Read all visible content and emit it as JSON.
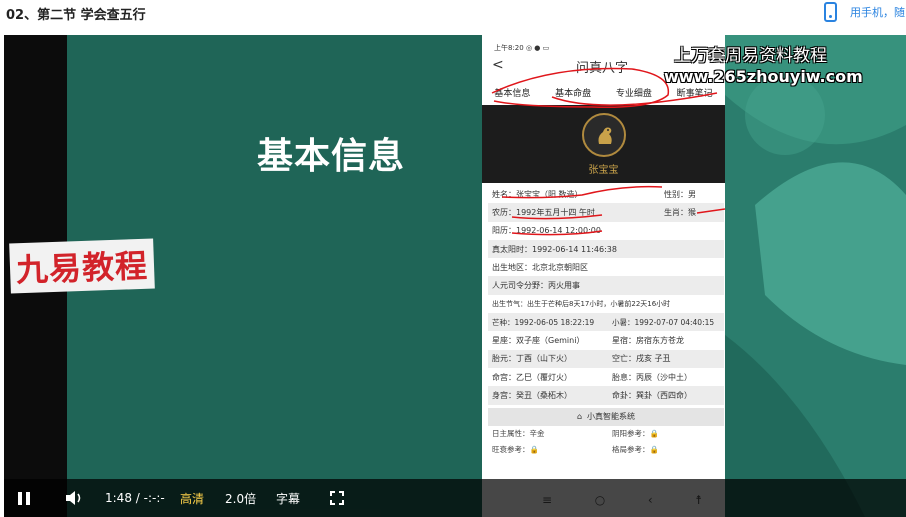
{
  "header": {
    "title": "02、第二节 学会查五行",
    "mobile_link": "用手机，随"
  },
  "slide": {
    "heading": "基本信息",
    "badge": "九易教程"
  },
  "watermark": {
    "line1": "上万套周易资料教程",
    "line2": "www.265zhouyiw.com"
  },
  "phone": {
    "status": "上午8:20 ◎ ● ▭",
    "back": "<",
    "title": "问真八字",
    "tabs": [
      "基本信息",
      "基本命盘",
      "专业细盘",
      "断事笔记"
    ],
    "hero_name": "张宝宝",
    "rows": [
      {
        "left": "姓名：张宝宝（阳 数造）",
        "right": "性别：男"
      },
      {
        "left": "农历：1992年五月十四 午时",
        "right": "生肖：猴"
      },
      {
        "left": "阳历：1992-06-14 12:00:00",
        "right": ""
      },
      {
        "left": "真太阳时：1992-06-14 11:46:38",
        "right": ""
      },
      {
        "left": "出生地区：北京北京朝阳区",
        "right": ""
      },
      {
        "left": "人元司令分野：丙火用事",
        "right": ""
      },
      {
        "left": "出生节气：出生于芒种后8天17小时，小暑前22天16小时",
        "right": ""
      },
      {
        "left": "芒种：1992-06-05 18:22:19",
        "right": "小暑：1992-07-07 04:40:15"
      },
      {
        "left": "星座：双子座（Gemini）",
        "right": "星宿：房宿东方苍龙"
      },
      {
        "left": "胎元：丁酉（山下火）",
        "right": "空亡：戌亥 子丑"
      },
      {
        "left": "命宫：乙巳（覆灯火）",
        "right": "胎息：丙辰（沙中土）"
      },
      {
        "left": "身宫：癸丑（桑柘木）",
        "right": "命卦：巽卦（西四命）"
      }
    ],
    "system_label": "小真智能系统",
    "small_rows": [
      {
        "left": "日主属性：辛金",
        "right": "阴阳参考：🔒"
      },
      {
        "left": "旺衰参考：🔒",
        "right": "格局参考：🔒"
      }
    ]
  },
  "controls": {
    "time": "1:48 / -:-:-",
    "quality": "高清",
    "speed": "2.0倍",
    "subtitle": "字幕"
  },
  "colors": {
    "slide_bg": "#1f6557",
    "badge_text": "#d2232a",
    "link_blue": "#2a83e0",
    "quality_yellow": "#ffd24a",
    "annotation_red": "#e0161b"
  }
}
